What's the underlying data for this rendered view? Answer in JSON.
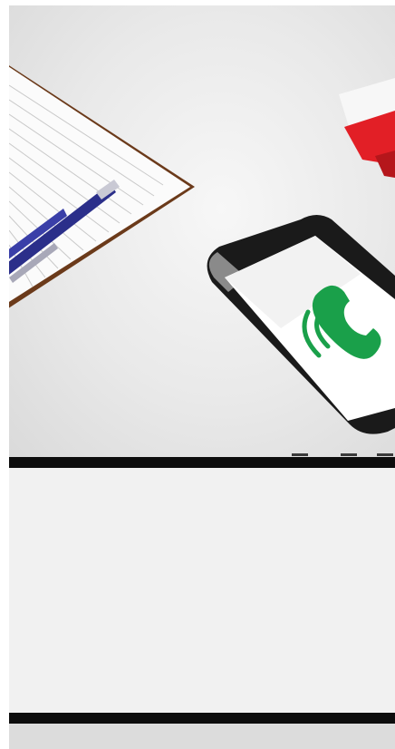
{
  "hero": {
    "illustration": "desk-with-notepad-pen-phone",
    "icons": [
      "notepad-icon",
      "pen-icon",
      "smartphone-icon",
      "phone-call-icon",
      "envelope-icon"
    ]
  },
  "colors": {
    "accent_green": "#1aa04a",
    "envelope_red": "#e21f26",
    "notepad_border": "#6b3a1a",
    "pen_blue": "#2b2f8a",
    "divider": "#0d0d0d",
    "panel": "#f1f1f1"
  }
}
